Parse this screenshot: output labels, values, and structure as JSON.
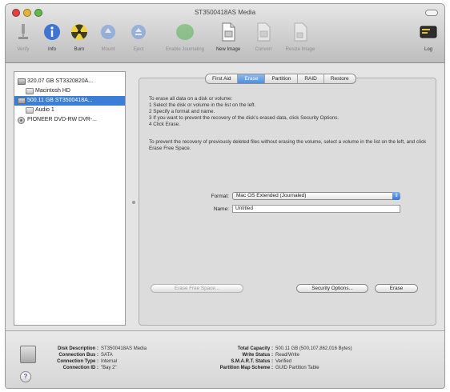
{
  "window": {
    "title": "ST3500418AS Media"
  },
  "toolbar": {
    "items": [
      {
        "label": "Verify",
        "icon": "microscope-icon",
        "enabled": false
      },
      {
        "label": "Info",
        "icon": "info-icon",
        "enabled": true
      },
      {
        "label": "Burn",
        "icon": "radiation-icon",
        "enabled": true
      },
      {
        "label": "Mount",
        "icon": "mount-icon",
        "enabled": false
      },
      {
        "label": "Eject",
        "icon": "eject-icon",
        "enabled": false
      },
      {
        "label": "Enable Journaling",
        "icon": "journal-icon",
        "enabled": false
      },
      {
        "label": "New Image",
        "icon": "new-image-icon",
        "enabled": true
      },
      {
        "label": "Convert",
        "icon": "convert-icon",
        "enabled": false
      },
      {
        "label": "Resize Image",
        "icon": "resize-image-icon",
        "enabled": false
      }
    ],
    "log_label": "Log"
  },
  "sidebar": {
    "items": [
      {
        "label": "320.07 GB ST3320820A...",
        "kind": "disk",
        "level": 0,
        "selected": false
      },
      {
        "label": "Macintosh HD",
        "kind": "volume",
        "level": 1,
        "selected": false
      },
      {
        "label": "500.11 GB ST3500418A...",
        "kind": "disk",
        "level": 0,
        "selected": true
      },
      {
        "label": "Audio 1",
        "kind": "volume",
        "level": 1,
        "selected": false
      },
      {
        "label": "PIONEER DVD-RW DVR-...",
        "kind": "optical",
        "level": 0,
        "selected": false
      }
    ]
  },
  "tabs": [
    {
      "label": "First Aid",
      "active": false
    },
    {
      "label": "Erase",
      "active": true
    },
    {
      "label": "Partition",
      "active": false
    },
    {
      "label": "RAID",
      "active": false
    },
    {
      "label": "Restore",
      "active": false
    }
  ],
  "erase": {
    "instructions": [
      "To erase all data on a disk or volume:",
      "1  Select the disk or volume in the list on the left.",
      "2  Specify a format and name.",
      "3  If you want to prevent the recovery of the disk's erased data, click Security Options.",
      "4  Click Erase."
    ],
    "free_space_note": "To prevent the recovery of previously deleted files without erasing the volume, select a volume in the list on the left, and click Erase Free Space.",
    "format_label": "Format:",
    "format_value": "Mac OS Extended (Journaled)",
    "name_label": "Name:",
    "name_value": "Untitled",
    "erase_free_space_label": "Erase Free Space...",
    "security_options_label": "Security Options...",
    "erase_label": "Erase"
  },
  "info": {
    "left": [
      {
        "key": "Disk Description :",
        "value": "ST3500418AS Media"
      },
      {
        "key": "Connection Bus :",
        "value": "SATA"
      },
      {
        "key": "Connection Type :",
        "value": "Internal"
      },
      {
        "key": "Connection ID :",
        "value": "\"Bay 2\""
      }
    ],
    "right": [
      {
        "key": "Total Capacity :",
        "value": "500.11 GB (500,107,862,016 Bytes)"
      },
      {
        "key": "Write Status :",
        "value": "Read/Write"
      },
      {
        "key": "S.M.A.R.T. Status :",
        "value": "Verified"
      },
      {
        "key": "Partition Map Scheme :",
        "value": "GUID Partition Table"
      }
    ],
    "help_label": "?"
  }
}
